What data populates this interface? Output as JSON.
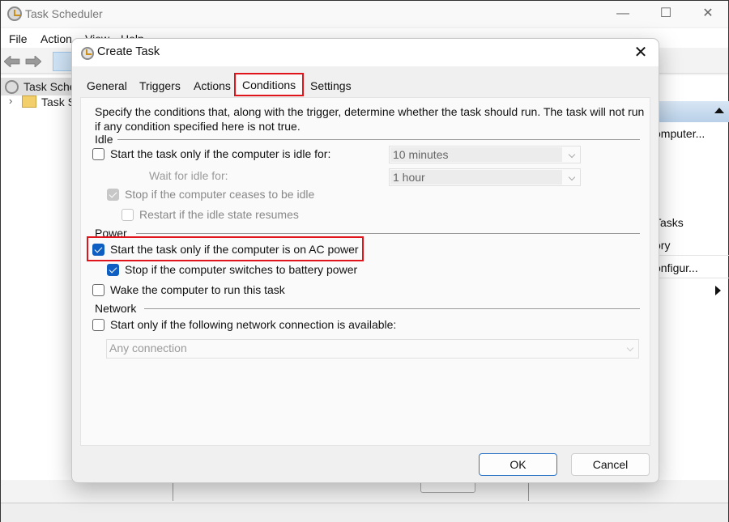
{
  "main_window": {
    "title": "Task Scheduler",
    "controls": {
      "minimize": "—",
      "maximize": "☐",
      "close": "✕"
    },
    "menu": [
      "File",
      "Action",
      "View",
      "Help"
    ],
    "tree": [
      {
        "label": "Task Scheduler (Local)",
        "visible_label": "Task Sche",
        "selected": true
      },
      {
        "label": "Task Scheduler Library",
        "visible_label": "Task S",
        "expanded": false
      }
    ],
    "actions_pane": {
      "items": [
        "omputer...",
        "Tasks",
        "ory",
        "onfigur..."
      ]
    }
  },
  "dialog": {
    "title": "Create Task",
    "close_label": "✕",
    "tabs": [
      {
        "label": "General",
        "active": false
      },
      {
        "label": "Triggers",
        "active": false
      },
      {
        "label": "Actions",
        "active": false
      },
      {
        "label": "Conditions",
        "active": true
      },
      {
        "label": "Settings",
        "active": false
      }
    ],
    "description": "Specify the conditions that, along with the trigger, determine whether the task should run.  The task will not run  if any condition specified here is not true.",
    "idle": {
      "label": "Idle",
      "start_if_idle": {
        "label": "Start the task only if the computer is idle for:",
        "checked": false,
        "value": "10 minutes"
      },
      "wait_for_idle": {
        "label": "Wait for idle for:",
        "value": "1 hour"
      },
      "stop_if_ceases": {
        "label": "Stop if the computer ceases to be idle",
        "checked": true,
        "disabled": true
      },
      "restart_if_resumes": {
        "label": "Restart if the idle state resumes",
        "checked": false,
        "disabled": true
      }
    },
    "power": {
      "label": "Power",
      "start_on_ac": {
        "label": "Start the task only if the computer is on AC power",
        "checked": true
      },
      "stop_on_battery": {
        "label": "Stop if the computer switches to battery power",
        "checked": true
      },
      "wake_to_run": {
        "label": "Wake the computer to run this task",
        "checked": false
      }
    },
    "network": {
      "label": "Network",
      "start_if_network": {
        "label": "Start only if the following network connection is available:",
        "checked": false
      },
      "connection": "Any connection"
    },
    "buttons": {
      "ok": "OK",
      "cancel": "Cancel"
    }
  },
  "colors": {
    "highlight": "#e0151b",
    "checkbox_checked": "#0f5fc2",
    "primary_button_border": "#2f77c6"
  }
}
